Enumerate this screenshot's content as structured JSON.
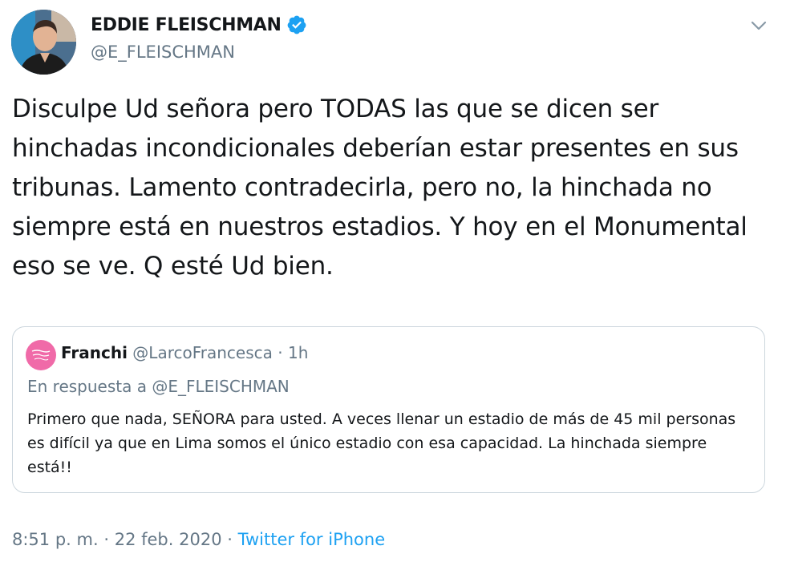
{
  "author": {
    "display_name": "EDDIE FLEISCHMAN",
    "handle": "@E_FLEISCHMAN",
    "verified": true
  },
  "tweet": {
    "text": "Disculpe Ud señora pero TODAS las que se dicen ser hinchadas incondicionales deberían estar presentes en sus tribunas. Lamento contradecirla, pero no, la hinchada no siempre está en nuestros estadios. Y hoy en el Monumental eso se ve. Q esté Ud bien."
  },
  "quoted_tweet": {
    "display_name": "Franchi",
    "handle": "@LarcoFrancesca",
    "separator": "·",
    "time_ago": "1h",
    "reply_to": "En respuesta a @E_FLEISCHMAN",
    "text": "Primero que nada, SEÑORA para usted. A veces llenar un estadio de más de 45 mil personas es difícil ya que en Lima somos el único estadio con esa capacidad. La hinchada siempre está!!"
  },
  "footer": {
    "time": "8:51 p. m.",
    "separator": "·",
    "date": "22 feb. 2020",
    "source": "Twitter for iPhone"
  },
  "colors": {
    "verified_badge": "#1da1f2",
    "link": "#1da1f2",
    "secondary_text": "#657786",
    "border": "#ccd6dd"
  },
  "icons": {
    "verified": "verified-badge-icon",
    "menu": "chevron-down-icon"
  }
}
